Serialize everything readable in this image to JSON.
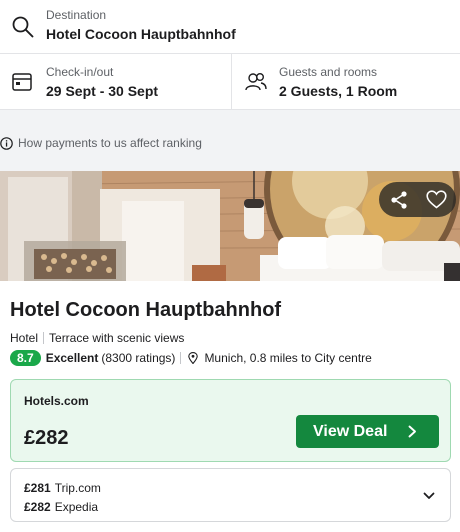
{
  "search": {
    "destination_label": "Destination",
    "destination_value": "Hotel Cocoon Hauptbahnhof",
    "checkin_label": "Check-in/out",
    "checkin_value": "29 Sept - 30 Sept",
    "guests_label": "Guests and rooms",
    "guests_value": "2 Guests, 1 Room"
  },
  "ranking_note": "How payments to us affect ranking",
  "hotel": {
    "name": "Hotel Cocoon Hauptbahnhof",
    "type": "Hotel",
    "feature": "Terrace with scenic views",
    "rating_score": "8.7",
    "rating_word": "Excellent",
    "rating_count": "(8300 ratings)",
    "location": "Munich, 0.8 miles to City centre"
  },
  "best_deal": {
    "provider": "Hotels.com",
    "price": "£282",
    "button_label": "View Deal"
  },
  "other_deals": [
    {
      "price": "£281",
      "provider": "Trip.com"
    },
    {
      "price": "£282",
      "provider": "Expedia"
    }
  ],
  "icons": {
    "destination": "search-icon",
    "dates": "calendar-icon",
    "guests": "people-icon",
    "ranking": "info-icon",
    "share": "share-icon",
    "favourite": "heart-icon",
    "location": "location-pin-icon",
    "view_deal": "chevron-right-icon",
    "expand": "chevron-down-icon"
  },
  "colors": {
    "rating_badge": "#1aa84a",
    "deal_button": "#14883e",
    "deal_background": "#eaf8ee",
    "deal_border": "#9fd9b1"
  }
}
